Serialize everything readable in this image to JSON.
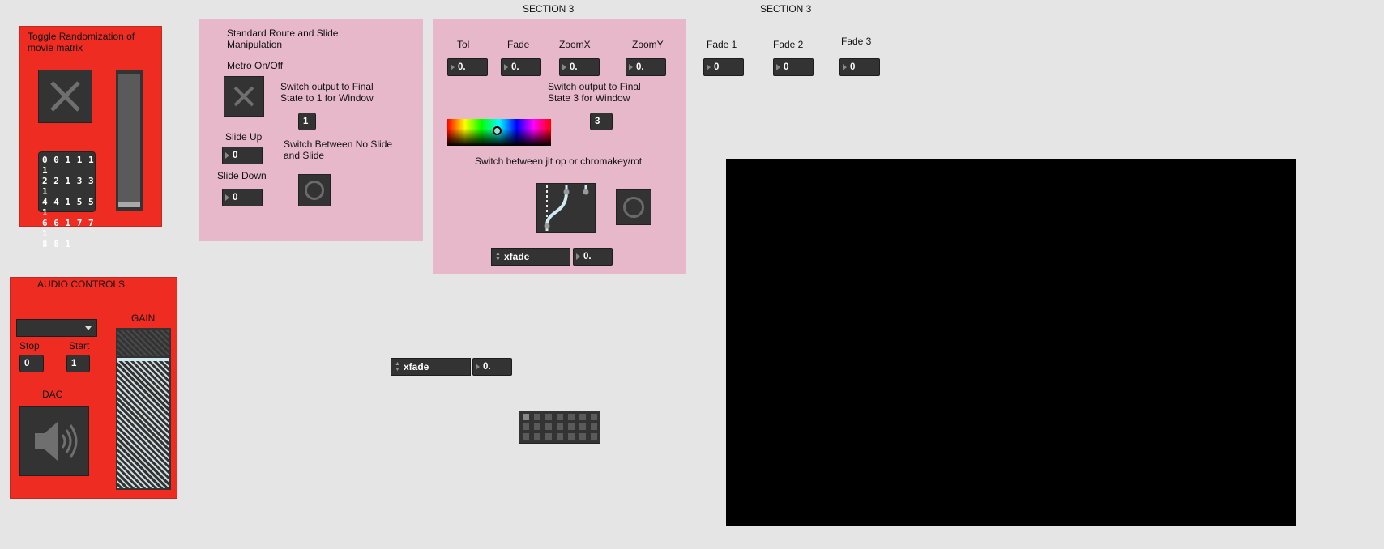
{
  "headings": {
    "section3_a": "SECTION 3",
    "section3_b": "SECTION 3"
  },
  "random_panel": {
    "title": "Toggle Randomization of movie matrix",
    "matrix_rows": [
      "0 0 1 1 1 1",
      "2 2 1 3 3 1",
      "4 4 1 5 5 1",
      "6 6 1 7 7 1",
      "8 8 1"
    ],
    "toggle_icon": "x-icon"
  },
  "route_panel": {
    "title": "Standard Route and Slide Manipulation",
    "metro_label": "Metro On/Off",
    "switch_output_label": "Switch output to Final State to 1 for Window",
    "switch_value": "1",
    "slide_up_label": "Slide Up",
    "slide_up_value": "0",
    "slide_down_label": "Slide Down",
    "slide_down_value": "0",
    "switch_slide_label": "Switch Between No Slide and Slide"
  },
  "chroma_panel": {
    "params": [
      {
        "label": "Tol",
        "value": "0."
      },
      {
        "label": "Fade",
        "value": "0."
      },
      {
        "label": "ZoomX",
        "value": "0."
      },
      {
        "label": "ZoomY",
        "value": "0."
      }
    ],
    "switch_output_label": "Switch output to Final State  3 for Window",
    "switch_value": "3",
    "switch_jit_label": "Switch between jit op or chromakey/rot",
    "menu_value": "xfade",
    "menu_number": "0."
  },
  "fades": [
    {
      "label": "Fade 1",
      "value": "0"
    },
    {
      "label": "Fade 2",
      "value": "0"
    },
    {
      "label": "Fade 3",
      "value": "0"
    }
  ],
  "audio_panel": {
    "title": "AUDIO CONTROLS",
    "gain_label": "GAIN",
    "stop_label": "Stop",
    "stop_value": "0",
    "start_label": "Start",
    "start_value": "1",
    "dac_label": "DAC",
    "menu_value": ""
  },
  "bottom_menu": {
    "menu_value": "xfade",
    "menu_number": "0."
  },
  "colors": {
    "red_panel": "#ee2c22",
    "pink_panel": "#e7b8c9",
    "object_bg": "#333333",
    "video_bg": "#000000"
  }
}
